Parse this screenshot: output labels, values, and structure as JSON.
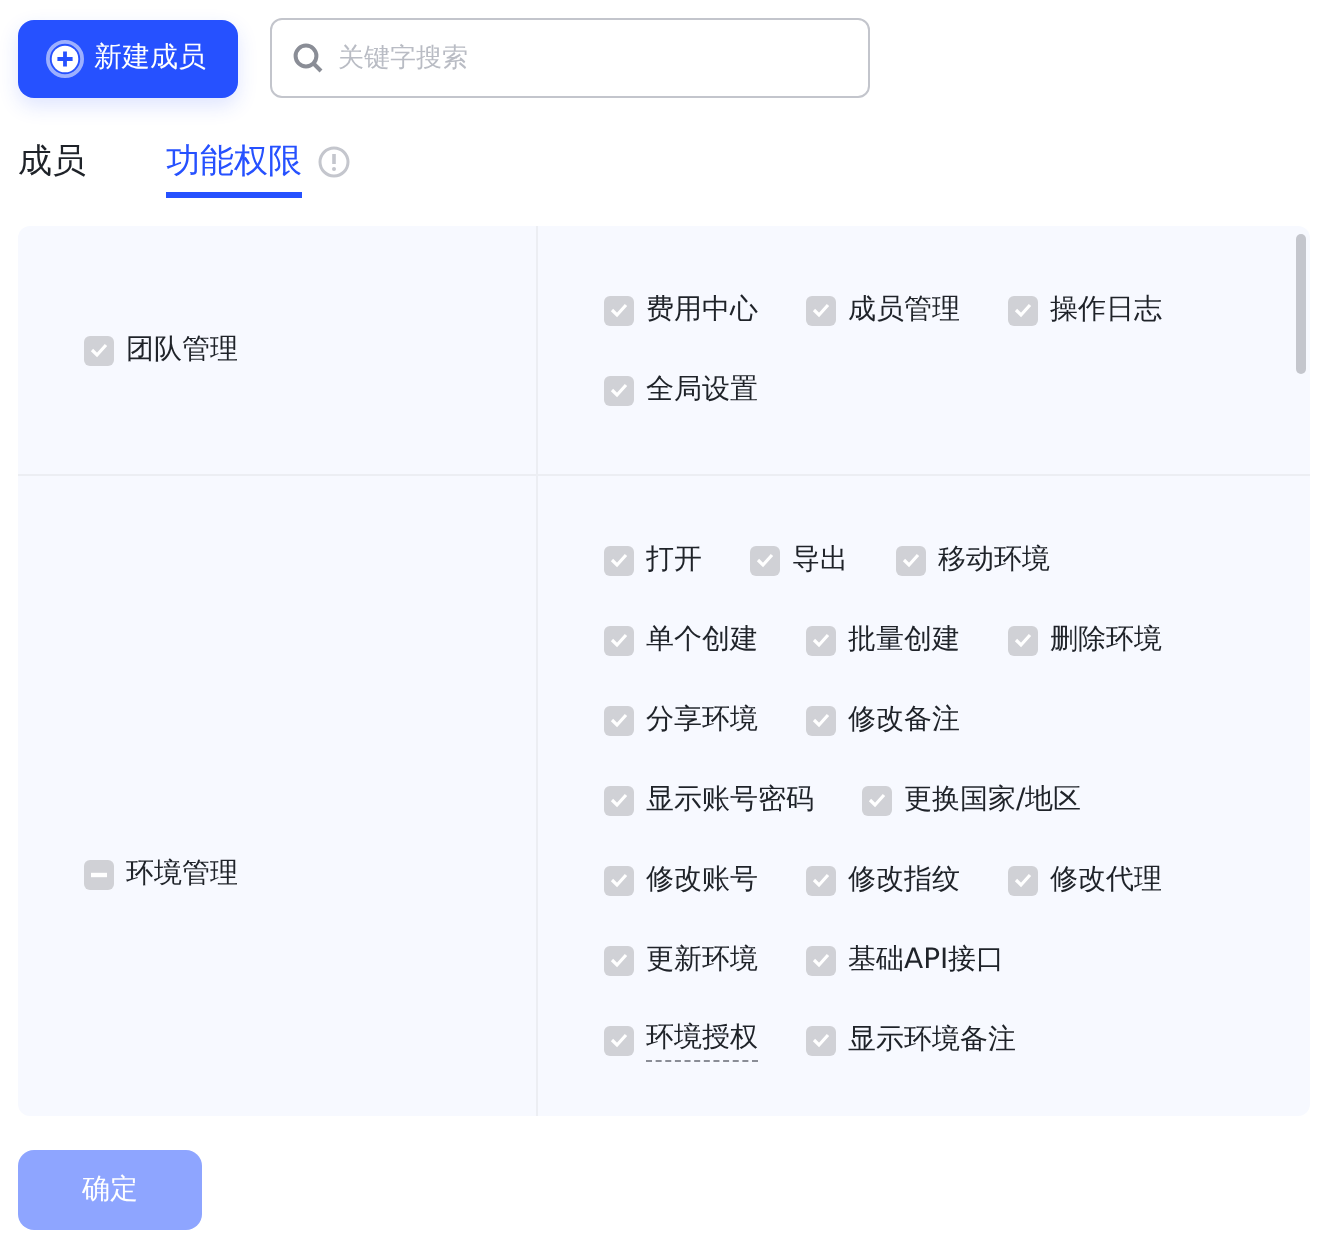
{
  "toolbar": {
    "add_button": "新建成员",
    "search": {
      "placeholder": "关键字搜索"
    }
  },
  "tabs": [
    {
      "label": "成员",
      "selected": false,
      "info": false
    },
    {
      "label": "功能权限",
      "selected": true,
      "info": true
    }
  ],
  "permission_groups": [
    {
      "label": "团队管理",
      "checked": true,
      "indeterminate": false,
      "disabled": true,
      "rows": [
        [
          {
            "label": "费用中心",
            "checked": true,
            "hint": false
          },
          {
            "label": "成员管理",
            "checked": true,
            "hint": false
          },
          {
            "label": "操作日志",
            "checked": true,
            "hint": false
          }
        ],
        [
          {
            "label": "全局设置",
            "checked": true,
            "hint": false
          }
        ]
      ]
    },
    {
      "label": "环境管理",
      "indeterminate": true,
      "disabled": true,
      "rows": [
        [
          {
            "label": "打开",
            "checked": true,
            "hint": false
          },
          {
            "label": "导出",
            "checked": true,
            "hint": false
          },
          {
            "label": "移动环境",
            "checked": true,
            "hint": false
          }
        ],
        [
          {
            "label": "单个创建",
            "checked": true,
            "hint": false
          },
          {
            "label": "批量创建",
            "checked": true,
            "hint": false
          },
          {
            "label": "删除环境",
            "checked": true,
            "hint": false
          }
        ],
        [
          {
            "label": "分享环境",
            "checked": true,
            "hint": false
          },
          {
            "label": "修改备注",
            "checked": true,
            "hint": false
          }
        ],
        [
          {
            "label": "显示账号密码",
            "checked": true,
            "hint": false
          },
          {
            "label": "更换国家/地区",
            "checked": true,
            "hint": false
          }
        ],
        [
          {
            "label": "修改账号",
            "checked": true,
            "hint": false
          },
          {
            "label": "修改指纹",
            "checked": true,
            "hint": false
          },
          {
            "label": "修改代理",
            "checked": true,
            "hint": false
          }
        ],
        [
          {
            "label": "更新环境",
            "checked": true,
            "hint": false
          },
          {
            "label": "基础API接口",
            "checked": true,
            "hint": false
          }
        ],
        [
          {
            "label": "环境授权",
            "checked": true,
            "hint": true
          },
          {
            "label": "显示环境备注",
            "checked": true,
            "hint": false
          }
        ]
      ]
    }
  ],
  "confirm_button": {
    "label": "确定",
    "disabled": true
  }
}
